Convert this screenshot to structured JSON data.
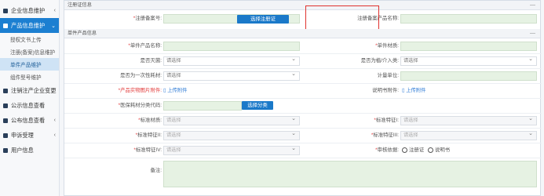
{
  "sidebar": {
    "items": [
      {
        "label": "企业信息维护",
        "chev": "‹"
      },
      {
        "label": "产品信息维护",
        "chev": "⌄"
      },
      {
        "label": "注销注产企业变更",
        "chev": "‹"
      },
      {
        "label": "公示信息查看",
        "chev": ""
      },
      {
        "label": "公布信息查看",
        "chev": "‹"
      },
      {
        "label": "申诉受理",
        "chev": "‹"
      },
      {
        "label": "用户信息",
        "chev": ""
      }
    ],
    "subitems": [
      "授权文书上传",
      "注册(备案)信息维护",
      "单件产品维护",
      "组件型号维护"
    ]
  },
  "section1": {
    "title": "注册证信息",
    "collapse": "—"
  },
  "section2": {
    "title": "单件产品信息",
    "collapse": "—"
  },
  "form": {
    "reg_no_label": "注册备案号:",
    "select_cert_btn": "选择注册证",
    "reg_product_name_label": "注册备案产品名称:",
    "product_name_label": "单件产品名称:",
    "material_label": "单件材质:",
    "sterile_label": "是否灭菌:",
    "sterile_value": "请选择",
    "trial_label": "是否为植/介入类:",
    "trial_value": "请选择",
    "disposable_label": "是否为一次性耗材:",
    "disposable_value": "请选择",
    "unit_label": "计量单位:",
    "image_label": "产品实物图片附件:",
    "image_link": "上传附件",
    "manual_label": "说明书附件:",
    "manual_link": "上传附件",
    "medical_code_label": "医保耗材分类代码:",
    "select_category_btn": "选择分类",
    "std_material_label": "标准材质:",
    "std_material_value": "请选择",
    "std_feature1_label": "标准特征I:",
    "std_feature1_value": "请选择",
    "std_feature2_label": "标准特征II:",
    "std_feature2_value": "请选择",
    "std_feature3_label": "标准特征III:",
    "std_feature3_value": "请选择",
    "std_feature4_label": "标准特征IV:",
    "std_feature4_value": "请选择",
    "review_basis_label": "审核依据:",
    "radio_cert": "注册证",
    "radio_manual": "说明书",
    "remark_label": "备注:"
  }
}
